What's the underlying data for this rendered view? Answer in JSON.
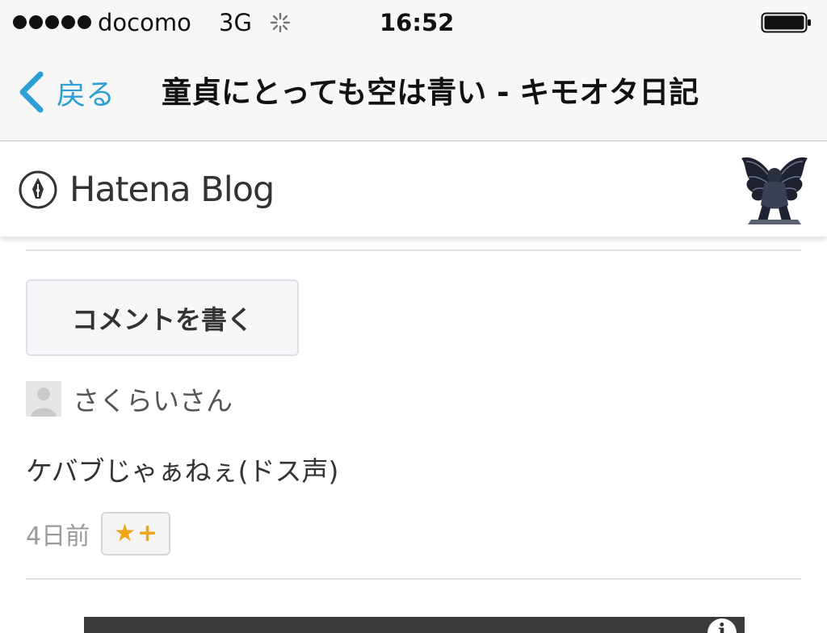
{
  "status_bar": {
    "signal_bars": 5,
    "carrier": "docomo",
    "network": "3G",
    "time": "16:52",
    "icons": [
      "signal-icon",
      "activity-icon",
      "battery-icon"
    ]
  },
  "nav_bar": {
    "back_label": "戻る",
    "title": "童貞にとっても空は青い - キモオタ日記",
    "accent_color": "#2e9fd6"
  },
  "blog_header": {
    "logo_text": "Hatena Blog",
    "logo_icon": "pen-nib-icon",
    "avatar_icon": "winged-figure-avatar"
  },
  "comments": {
    "write_button_label": "コメントを書く",
    "items": [
      {
        "author": "さくらいさん",
        "body": "ケバブじゃぁねぇ(ドス声)",
        "time": "4日前",
        "star_button_icon": "star-plus-icon"
      }
    ]
  },
  "embed": {
    "info_glyph": "i"
  }
}
